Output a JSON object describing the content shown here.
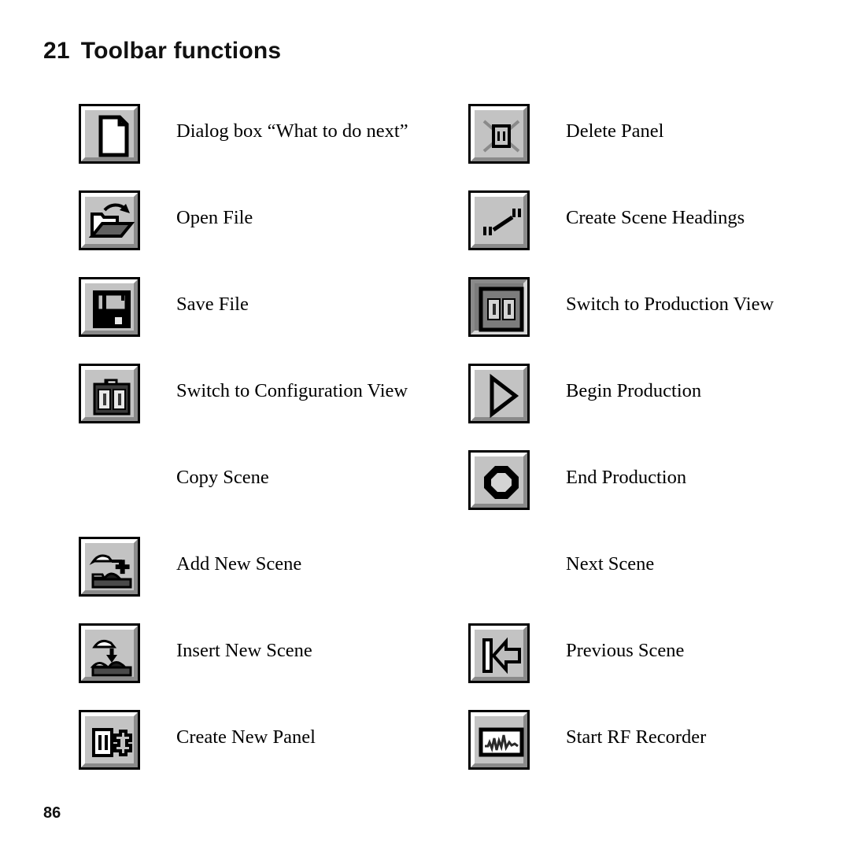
{
  "document": {
    "chapter_number": "21",
    "title": "Toolbar functions",
    "page_number": "86"
  },
  "colors": {
    "button_face": "#c3c3c3",
    "button_highlight": "#ffffff",
    "button_shadow": "#8a8a8a",
    "button_border": "#000000",
    "pressed_face": "#7c7c7c",
    "page_background": "#ffffff",
    "text": "#000000"
  },
  "columns": [
    {
      "name": "left-column",
      "entries": [
        {
          "icon": "new-document-icon",
          "has_icon": true,
          "label": "Dialog box “What to do next”"
        },
        {
          "icon": "open-folder-icon",
          "has_icon": true,
          "label": "Open File"
        },
        {
          "icon": "floppy-disk-save-icon",
          "has_icon": true,
          "label": "Save File"
        },
        {
          "icon": "configuration-view-icon",
          "has_icon": true,
          "label": "Switch to Configuration View"
        },
        {
          "icon": "copy-scene-icon",
          "has_icon": false,
          "label": "Copy Scene"
        },
        {
          "icon": "add-new-scene-icon",
          "has_icon": true,
          "label": "Add New Scene"
        },
        {
          "icon": "insert-new-scene-icon",
          "has_icon": true,
          "label": "Insert New Scene"
        },
        {
          "icon": "create-new-panel-icon",
          "has_icon": true,
          "label": "Create New Panel"
        }
      ]
    },
    {
      "name": "right-column",
      "entries": [
        {
          "icon": "delete-panel-icon",
          "has_icon": true,
          "label": "Delete Panel"
        },
        {
          "icon": "create-scene-headings-icon",
          "has_icon": true,
          "label": "Create Scene Headings"
        },
        {
          "icon": "production-view-icon",
          "has_icon": true,
          "label": "Switch to Production View"
        },
        {
          "icon": "begin-production-icon",
          "has_icon": true,
          "label": "Begin Production"
        },
        {
          "icon": "end-production-icon",
          "has_icon": true,
          "label": "End Production"
        },
        {
          "icon": "next-scene-icon",
          "has_icon": false,
          "label": "Next Scene"
        },
        {
          "icon": "previous-scene-icon",
          "has_icon": true,
          "label": "Previous Scene"
        },
        {
          "icon": "start-rf-recorder-icon",
          "has_icon": true,
          "label": "Start RF Recorder"
        }
      ]
    }
  ]
}
